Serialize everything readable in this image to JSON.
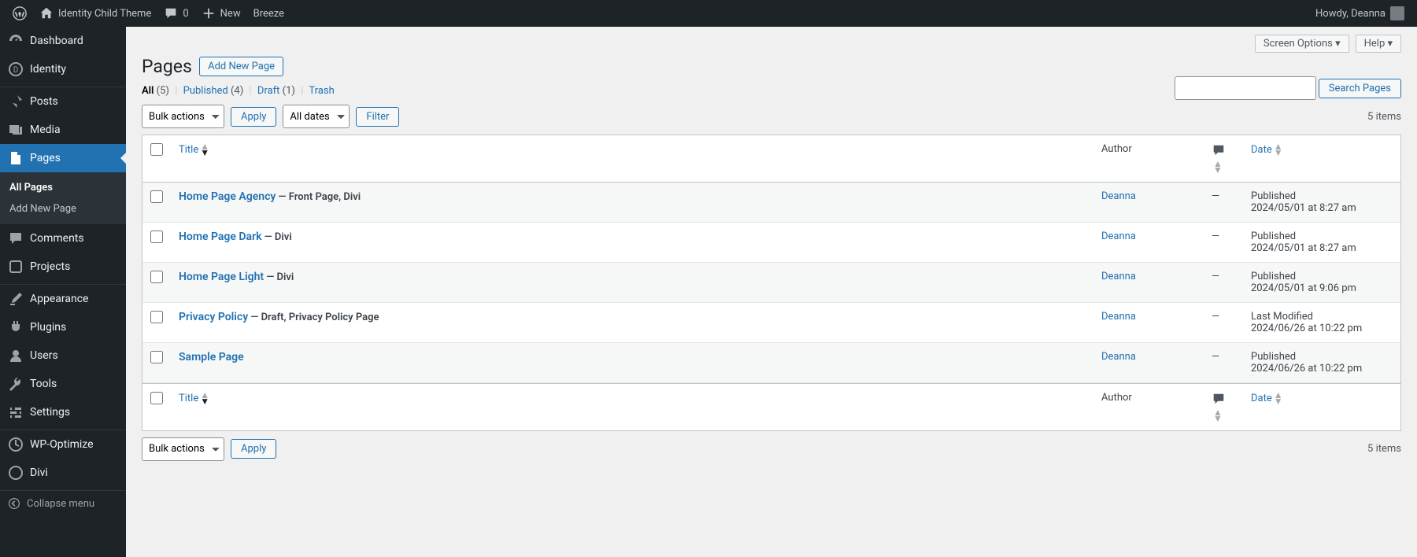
{
  "adminbar": {
    "site_name": "Identity Child Theme",
    "comments_count": "0",
    "new_label": "New",
    "breeze_label": "Breeze",
    "howdy": "Howdy, Deanna"
  },
  "sidebar": {
    "items": [
      {
        "label": "Dashboard"
      },
      {
        "label": "Identity"
      },
      {
        "label": "Posts"
      },
      {
        "label": "Media"
      },
      {
        "label": "Pages"
      },
      {
        "label": "Comments"
      },
      {
        "label": "Projects"
      },
      {
        "label": "Appearance"
      },
      {
        "label": "Plugins"
      },
      {
        "label": "Users"
      },
      {
        "label": "Tools"
      },
      {
        "label": "Settings"
      },
      {
        "label": "WP-Optimize"
      },
      {
        "label": "Divi"
      }
    ],
    "submenu": {
      "all_pages": "All Pages",
      "add_new": "Add New Page"
    },
    "collapse": "Collapse menu"
  },
  "screen": {
    "screen_options": "Screen Options",
    "help": "Help"
  },
  "heading": "Pages",
  "add_new_btn": "Add New Page",
  "views": {
    "all_label": "All",
    "all_count": "(5)",
    "published_label": "Published",
    "published_count": "(4)",
    "draft_label": "Draft",
    "draft_count": "(1)",
    "trash_label": "Trash"
  },
  "search": {
    "button": "Search Pages",
    "value": ""
  },
  "bulk": {
    "placeholder": "Bulk actions",
    "apply": "Apply"
  },
  "dates": {
    "placeholder": "All dates",
    "filter": "Filter"
  },
  "items_count": "5 items",
  "columns": {
    "title": "Title",
    "author": "Author",
    "date": "Date"
  },
  "rows": [
    {
      "title": "Home Page Agency",
      "state": " — Front Page, Divi",
      "author": "Deanna",
      "comments": "—",
      "date_status": "Published",
      "date_val": "2024/05/01 at 8:27 am"
    },
    {
      "title": "Home Page Dark",
      "state": " — Divi",
      "author": "Deanna",
      "comments": "—",
      "date_status": "Published",
      "date_val": "2024/05/01 at 8:27 am"
    },
    {
      "title": "Home Page Light",
      "state": " — Divi",
      "author": "Deanna",
      "comments": "—",
      "date_status": "Published",
      "date_val": "2024/05/01 at 9:06 pm"
    },
    {
      "title": "Privacy Policy",
      "state": " — Draft, Privacy Policy Page",
      "author": "Deanna",
      "comments": "—",
      "date_status": "Last Modified",
      "date_val": "2024/06/26 at 10:22 pm"
    },
    {
      "title": "Sample Page",
      "state": "",
      "author": "Deanna",
      "comments": "—",
      "date_status": "Published",
      "date_val": "2024/06/26 at 10:22 pm"
    }
  ]
}
